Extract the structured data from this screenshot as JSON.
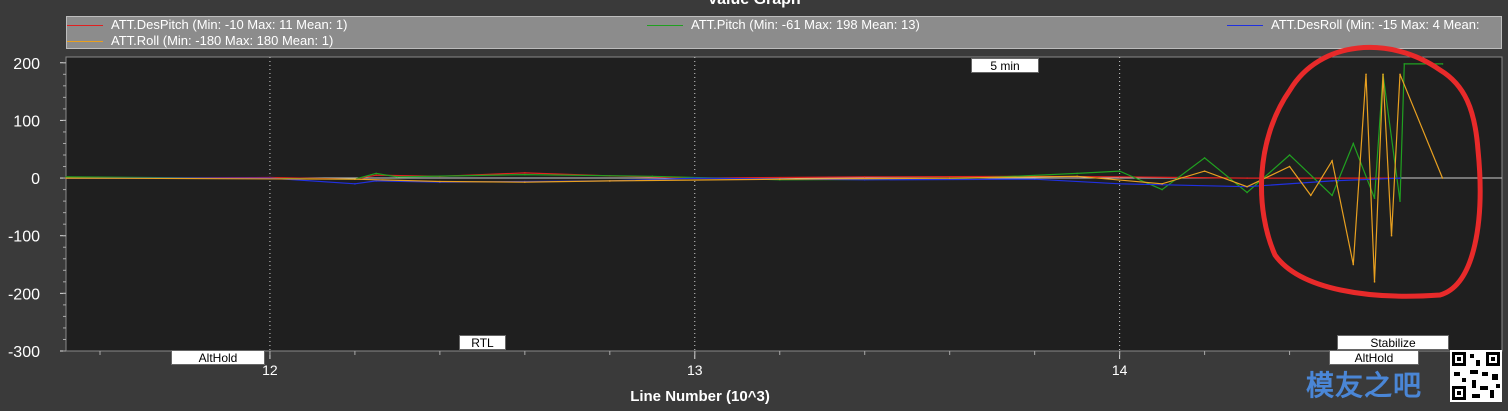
{
  "window": {
    "title": "Value Graph"
  },
  "legend": [
    {
      "label": "ATT.DesPitch (Min: -10 Max: 11 Mean: 1)",
      "color": "#e02020"
    },
    {
      "label": "ATT.Pitch (Min: -61 Max: 198 Mean: 13)",
      "color": "#20a020"
    },
    {
      "label": "ATT.DesRoll (Min: -15 Max: 4 Mean:",
      "color": "#2030e0"
    },
    {
      "label": "ATT.Roll (Min: -180 Max: 180 Mean: 1)",
      "color": "#e8a020"
    }
  ],
  "annotations": {
    "time_marker": "5 min",
    "modes": [
      "AltHold",
      "RTL",
      "Stabilize",
      "AltHold"
    ]
  },
  "overlay": {
    "circle_color": "#e82a2a"
  },
  "watermark": {
    "text": "模友之吧"
  },
  "chart_data": {
    "type": "line",
    "title": "Value Graph",
    "xlabel": "Line Number (10^3)",
    "ylabel": "",
    "xlim": [
      11.52,
      14.9
    ],
    "ylim": [
      -300,
      210
    ],
    "xticks": [
      12,
      13,
      14
    ],
    "yticks": [
      -300,
      -200,
      -100,
      0,
      100,
      200
    ],
    "grid": true,
    "legend_position": "top",
    "series": [
      {
        "name": "ATT.DesPitch",
        "color": "#e02020",
        "x": [
          11.52,
          12.0,
          12.2,
          12.25,
          12.4,
          12.6,
          12.8,
          13.0,
          13.4,
          13.8,
          14.0,
          14.3,
          14.5,
          14.6,
          14.66
        ],
        "y": [
          0,
          1,
          -2,
          5,
          3,
          9,
          4,
          0,
          2,
          3,
          2,
          0,
          0,
          0,
          0
        ]
      },
      {
        "name": "ATT.Pitch",
        "color": "#20a020",
        "x": [
          11.52,
          12.2,
          12.25,
          12.3,
          12.6,
          12.9,
          13.2,
          13.6,
          13.9,
          14.0,
          14.1,
          14.2,
          14.3,
          14.4,
          14.5,
          14.55,
          14.6,
          14.62,
          14.66,
          14.67,
          14.76
        ],
        "y": [
          2,
          -2,
          8,
          2,
          6,
          3,
          -3,
          -2,
          8,
          12,
          -20,
          35,
          -25,
          40,
          -30,
          60,
          -35,
          180,
          -40,
          198,
          198
        ]
      },
      {
        "name": "ATT.DesRoll",
        "color": "#2030e0",
        "x": [
          11.52,
          12.0,
          12.2,
          12.25,
          12.4,
          12.6,
          12.8,
          13.0,
          13.4,
          13.8,
          14.0,
          14.3,
          14.5,
          14.66
        ],
        "y": [
          0,
          0,
          -10,
          -5,
          -7,
          -6,
          -5,
          0,
          -3,
          -2,
          -10,
          -15,
          -5,
          0
        ]
      },
      {
        "name": "ATT.Roll",
        "color": "#e8a020",
        "x": [
          11.52,
          12.2,
          12.4,
          12.6,
          12.8,
          13.2,
          13.6,
          13.9,
          14.1,
          14.2,
          14.3,
          14.4,
          14.45,
          14.5,
          14.55,
          14.58,
          14.6,
          14.62,
          14.64,
          14.66,
          14.76
        ],
        "y": [
          0,
          -2,
          -6,
          -7,
          -5,
          -2,
          0,
          3,
          -10,
          12,
          -15,
          20,
          -30,
          30,
          -150,
          180,
          -180,
          180,
          -100,
          180,
          0
        ]
      }
    ]
  }
}
